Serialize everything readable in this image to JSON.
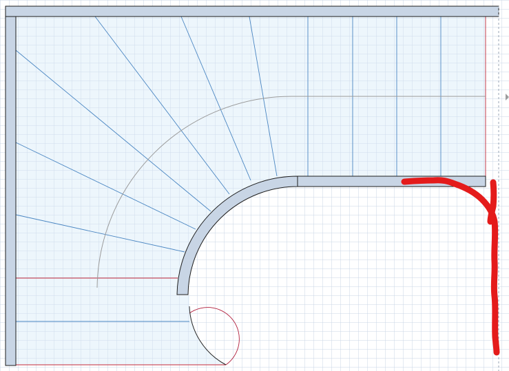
{
  "canvas": {
    "background": "#ffffff",
    "grid_color": "#c9d6e6",
    "stair_fill": "#e9f4fb",
    "wall_fill": "#c8d5e5",
    "wall_stroke": "#1d1d1d",
    "tread_line_color": "#4a86c2",
    "walk_line_color": "#9a9a9a",
    "edge_red": "#c42a3a",
    "annotation_color": "#e41b1b",
    "arrow_color": "#9c9c9c"
  },
  "elements": {
    "stair_area": "stair-plan",
    "treads": "tread-lines",
    "walk_line": "walking-line",
    "swing_arc": "door-swing-arc",
    "annotation": "red-marker-stroke",
    "arrow": "direction-arrow-icon"
  }
}
